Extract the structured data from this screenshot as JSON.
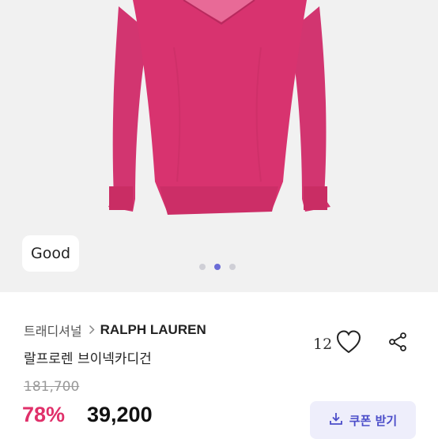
{
  "gallery": {
    "condition_badge": "Good",
    "page_indicator": {
      "total": 3,
      "active": 2
    }
  },
  "product": {
    "category": "트래디셔널",
    "brand": "RALPH LAUREN",
    "title": "랄프로렌 브이넥카디건",
    "like_count": "12",
    "original_price": "181,700",
    "discount_rate": "78%",
    "sale_price": "39,200"
  },
  "actions": {
    "coupon_label": "쿠폰 받기"
  },
  "icons": {
    "breadcrumb_separator": "chevron-right-icon",
    "like": "heart-icon",
    "share": "share-icon",
    "coupon": "download-icon"
  },
  "colors": {
    "sweater": "#d8336f",
    "discount": "#e0306a",
    "coupon_text": "#4b4dc9",
    "coupon_bg": "#eeeefb",
    "active_dot": "#6b6cd6"
  }
}
